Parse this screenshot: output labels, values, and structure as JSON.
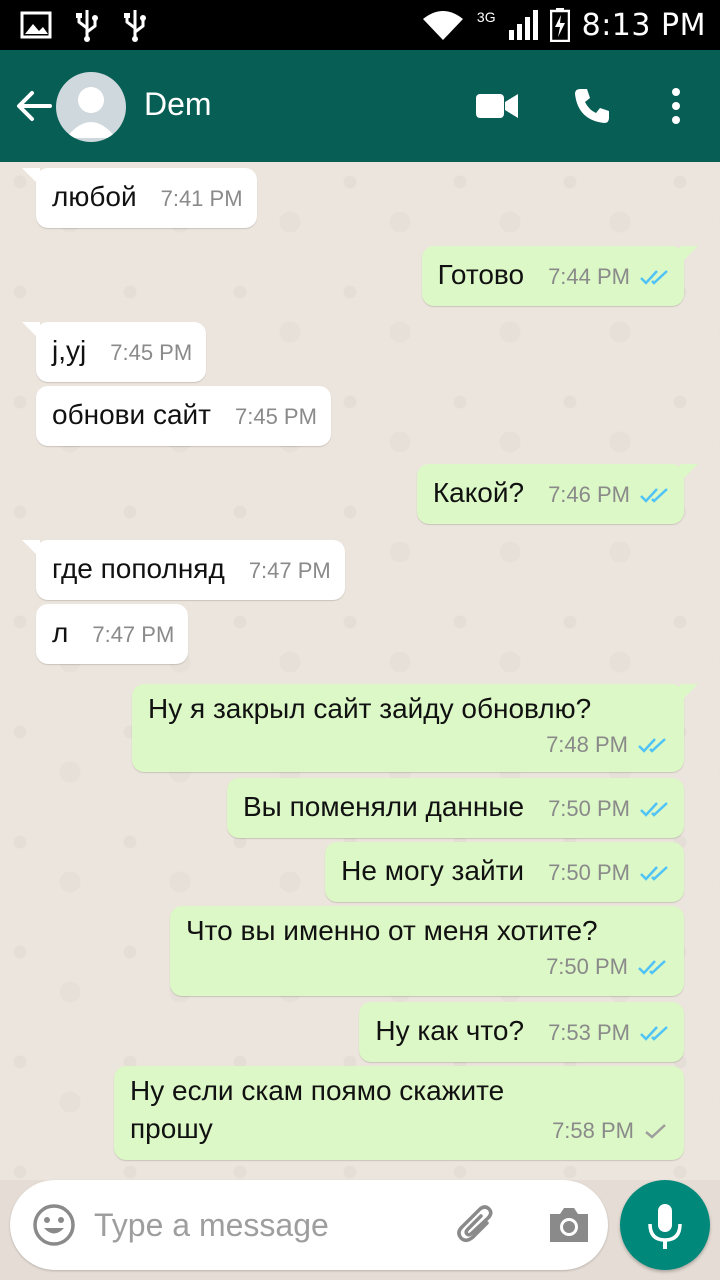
{
  "status_bar": {
    "time": "8:13 PM",
    "network": "3G"
  },
  "header": {
    "contact_name": "Dem"
  },
  "messages": [
    {
      "dir": "in",
      "text": "любой",
      "time": "7:41 PM"
    },
    {
      "dir": "out",
      "text": "Готово",
      "time": "7:44 PM",
      "status": "read"
    },
    {
      "dir": "in",
      "text": "j,yj",
      "time": "7:45 PM"
    },
    {
      "dir": "in",
      "text": "обнови сайт",
      "time": "7:45 PM"
    },
    {
      "dir": "out",
      "text": "Какой?",
      "time": "7:46 PM",
      "status": "read"
    },
    {
      "dir": "in",
      "text": "где пополняд",
      "time": "7:47 PM"
    },
    {
      "dir": "in",
      "text": "л",
      "time": "7:47 PM"
    },
    {
      "dir": "out",
      "text": "Ну я закрыл сайт зайду обновлю?",
      "time": "7:48 PM",
      "status": "read"
    },
    {
      "dir": "out",
      "text": "Вы поменяли данные",
      "time": "7:50 PM",
      "status": "read"
    },
    {
      "dir": "out",
      "text": "Не могу зайти",
      "time": "7:50 PM",
      "status": "read"
    },
    {
      "dir": "out",
      "text": "Что вы именно от меня хотите?",
      "time": "7:50 PM",
      "status": "read"
    },
    {
      "dir": "out",
      "text": "Ну как что?",
      "time": "7:53 PM",
      "status": "read"
    },
    {
      "dir": "out",
      "text_lines": [
        "Ну если скам поямо скажите",
        "прошу"
      ],
      "time": "7:58 PM",
      "status": "sent"
    }
  ],
  "composer": {
    "placeholder": "Type a message"
  },
  "colors": {
    "header": "#075e54",
    "outgoing_bubble": "#dcf8c6",
    "incoming_bubble": "#ffffff",
    "read_tick": "#4fc3f7",
    "fab": "#00897b"
  },
  "icons": [
    "back-arrow-icon",
    "avatar-icon",
    "video-call-icon",
    "phone-icon",
    "more-vert-icon",
    "emoji-icon",
    "attach-icon",
    "camera-icon",
    "mic-icon"
  ]
}
